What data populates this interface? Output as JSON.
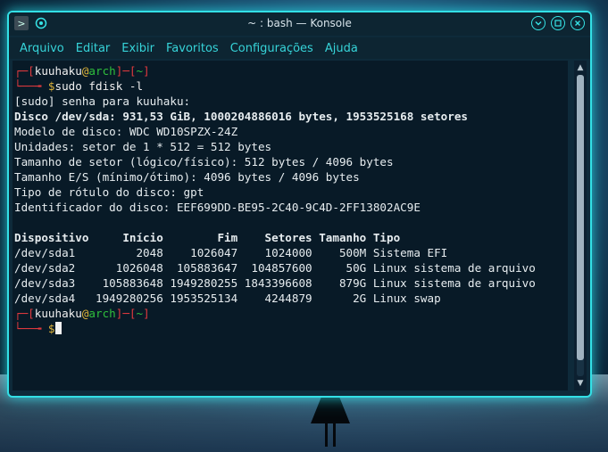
{
  "window": {
    "title": "~ : bash — Konsole",
    "accent_color": "#33e0e6"
  },
  "menubar": {
    "items": [
      "Arquivo",
      "Editar",
      "Exibir",
      "Favoritos",
      "Configurações",
      "Ajuda"
    ]
  },
  "terminal": {
    "prompt1": {
      "open_bracket": "┌─[",
      "user": "kuuhaku",
      "at": "@",
      "host": "arch",
      "mid": "]─[",
      "cwd": "~",
      "close": "]"
    },
    "cmd_prefix": "└──╼ ",
    "dollar": "$",
    "command": "sudo fdisk -l",
    "lines": [
      "[sudo] senha para kuuhaku:",
      "Disco /dev/sda: 931,53 GiB, 1000204886016 bytes, 1953525168 setores",
      "Modelo de disco: WDC WD10SPZX-24Z",
      "Unidades: setor de 1 * 512 = 512 bytes",
      "Tamanho de setor (lógico/físico): 512 bytes / 4096 bytes",
      "Tamanho E/S (mínimo/ótimo): 4096 bytes / 4096 bytes",
      "Tipo de rótulo do disco: gpt",
      "Identificador do disco: EEF699DD-BE95-2C40-9C4D-2FF13802AC9E",
      "",
      "Dispositivo     Início        Fim    Setores Tamanho Tipo",
      "/dev/sda1         2048    1026047    1024000    500M Sistema EFI",
      "/dev/sda2      1026048  105883647  104857600     50G Linux sistema de arquivo",
      "/dev/sda3    105883648 1949280255 1843396608    879G Linux sistema de arquivo",
      "/dev/sda4   1949280256 1953525134    4244879      2G Linux swap"
    ],
    "prompt2": {
      "open_bracket": "┌─[",
      "user": "kuuhaku",
      "at": "@",
      "host": "arch",
      "mid": "]─[",
      "cwd": "~",
      "close": "]"
    },
    "prompt2_dollar": "$"
  },
  "icons": {
    "app": "konsole-icon",
    "pin": "pin-icon",
    "minimize": "minimize-icon",
    "maximize": "maximize-icon",
    "close": "close-icon"
  }
}
